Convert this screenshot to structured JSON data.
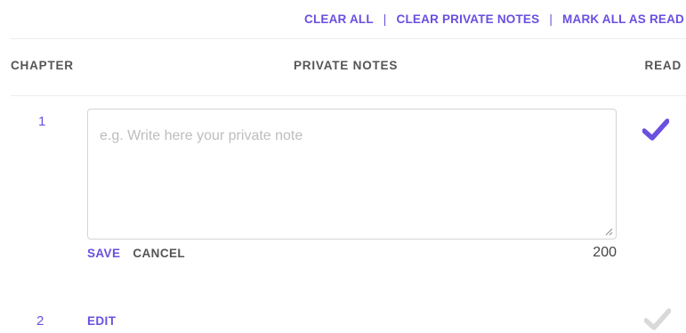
{
  "top_actions": {
    "clear_all": "CLEAR ALL",
    "separator": "|",
    "clear_private_notes": "CLEAR PRIVATE NOTES",
    "mark_all_as_read": "MARK ALL AS READ"
  },
  "table": {
    "headers": {
      "chapter": "CHAPTER",
      "private_notes": "PRIVATE NOTES",
      "read": "READ"
    },
    "rows": [
      {
        "chapter": "1",
        "note_placeholder": "e.g. Write here your private note",
        "save_label": "SAVE",
        "cancel_label": "CANCEL",
        "char_count": "200",
        "read": true
      },
      {
        "chapter": "2",
        "edit_label": "EDIT",
        "read": false
      }
    ]
  },
  "icons": {
    "read_check": "checkmark-icon",
    "resize": "resize-handle-icon"
  },
  "colors": {
    "accent": "#6a4fe0",
    "read_checked": "#6a4fe0",
    "read_unchecked": "#d9d9d9",
    "header_text": "#555555",
    "placeholder": "#bdbdbd"
  }
}
